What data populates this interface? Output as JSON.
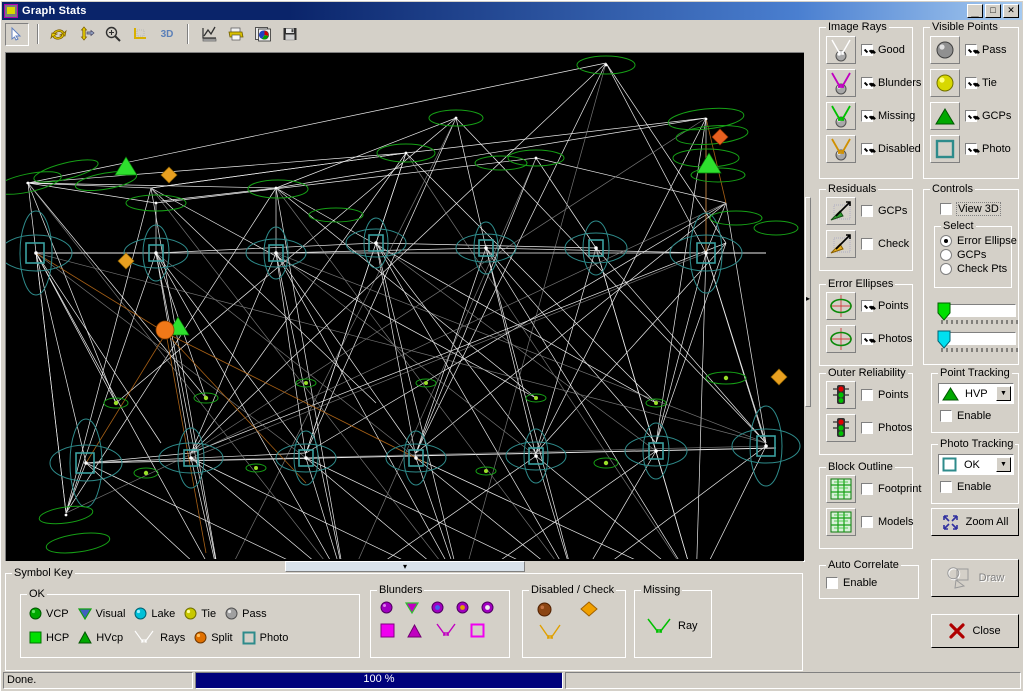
{
  "window": {
    "title": "Graph Stats",
    "icon": "app-icon",
    "buttons": {
      "minimize": "_",
      "maximize": "□",
      "close": "✕"
    }
  },
  "toolbar": {
    "items": [
      {
        "name": "select-arrow",
        "label": "",
        "pressed": true
      },
      {
        "name": "rotate",
        "label": ""
      },
      {
        "name": "pan-move",
        "label": ""
      },
      {
        "name": "zoom",
        "label": ""
      },
      {
        "name": "axes",
        "label": ""
      },
      {
        "name": "view-3d",
        "label": "3D"
      },
      {
        "name": "graph",
        "label": ""
      },
      {
        "name": "print",
        "label": ""
      },
      {
        "name": "palette",
        "label": ""
      },
      {
        "name": "save",
        "label": ""
      }
    ]
  },
  "image_rays": {
    "legend": "Image Rays",
    "items": [
      {
        "label": "Good",
        "checked": true,
        "color": "#ffffff"
      },
      {
        "label": "Blunders",
        "checked": true,
        "color": "#c000c0"
      },
      {
        "label": "Missing",
        "checked": true,
        "color": "#00c000"
      },
      {
        "label": "Disabled",
        "checked": true,
        "color": "#d09000"
      }
    ]
  },
  "residuals": {
    "legend": "Residuals",
    "items": [
      {
        "label": "GCPs",
        "checked": false,
        "color": "#2e9b2e"
      },
      {
        "label": "Check",
        "checked": false,
        "color": "#e8b020"
      }
    ]
  },
  "error_ellipses": {
    "legend": "Error Ellipses",
    "items": [
      {
        "label": "Points",
        "checked": true
      },
      {
        "label": "Photos",
        "checked": true
      }
    ]
  },
  "outer_reliability": {
    "legend": "Outer Reliability",
    "items": [
      {
        "label": "Points",
        "checked": false
      },
      {
        "label": "Photos",
        "checked": false
      }
    ]
  },
  "block_outline": {
    "legend": "Block Outline",
    "items": [
      {
        "label": "Footprint",
        "checked": false
      },
      {
        "label": "Models",
        "checked": false
      }
    ]
  },
  "auto_correlate": {
    "legend": "Auto Correlate",
    "items": [
      {
        "label": "Enable",
        "checked": false
      }
    ]
  },
  "visible_points": {
    "legend": "Visible Points",
    "items": [
      {
        "label": "Pass",
        "checked": true,
        "symbol": "circle",
        "color": "#909090"
      },
      {
        "label": "Tie",
        "checked": true,
        "symbol": "circle",
        "color": "#d8d800"
      },
      {
        "label": "GCPs",
        "checked": true,
        "symbol": "triangle",
        "color": "#00a800"
      },
      {
        "label": "Photo",
        "checked": true,
        "symbol": "square",
        "color": "#2e8b8b"
      }
    ]
  },
  "controls": {
    "legend": "Controls",
    "view_3d": {
      "label": "View 3D",
      "checked": false
    },
    "select": {
      "legend": "Select",
      "options": [
        {
          "label": "Error Ellipse",
          "selected": true
        },
        {
          "label": "GCPs",
          "selected": false
        },
        {
          "label": "Check Pts",
          "selected": false
        }
      ]
    },
    "sliders": [
      {
        "name": "ellipse-scale-slider",
        "color": "#00e000",
        "value": 0
      },
      {
        "name": "ray-scale-slider",
        "color": "#00e0f0",
        "value": 0
      }
    ]
  },
  "point_tracking": {
    "legend": "Point Tracking",
    "value": "HVP",
    "symbol": "triangle",
    "enable": {
      "label": "Enable",
      "checked": false
    }
  },
  "photo_tracking": {
    "legend": "Photo Tracking",
    "value": "OK",
    "symbol": "square",
    "enable": {
      "label": "Enable",
      "checked": false
    }
  },
  "actions": {
    "zoom_all": "Zoom All",
    "draw": "Draw",
    "close": "Close"
  },
  "symbol_key": {
    "legend": "Symbol Key",
    "ok": {
      "legend": "OK",
      "row1": [
        {
          "label": "VCP",
          "symbol": "circle",
          "color": "#00a800"
        },
        {
          "label": "Visual",
          "symbol": "triangle-down",
          "color": "#4060c0"
        },
        {
          "label": "Lake",
          "symbol": "circle",
          "color": "#00c0d8"
        },
        {
          "label": "Tie",
          "symbol": "circle",
          "color": "#c8c800"
        },
        {
          "label": "Pass",
          "symbol": "circle",
          "color": "#a0a0a0"
        }
      ],
      "row2": [
        {
          "label": "HCP",
          "symbol": "square",
          "color": "#00e000"
        },
        {
          "label": "HVcp",
          "symbol": "triangle-up",
          "color": "#00a800"
        },
        {
          "label": "Rays",
          "symbol": "rays",
          "color": "#ffffff"
        },
        {
          "label": "Split",
          "symbol": "circle",
          "color": "#e07000"
        },
        {
          "label": "Photo",
          "symbol": "square-open",
          "color": "#2e8b8b"
        }
      ]
    },
    "blunders": {
      "legend": "Blunders",
      "row1": [
        {
          "symbol": "circle",
          "color": "#a000c0"
        },
        {
          "symbol": "triangle-down",
          "color": "#c000c0"
        },
        {
          "symbol": "circle-dot",
          "color": "#a000c0",
          "dot": "#4060f0"
        },
        {
          "symbol": "circle-dot",
          "color": "#a000c0",
          "dot": "#e0a000"
        },
        {
          "symbol": "circle-dot",
          "color": "#a000c0",
          "dot": "#e0e0e0"
        }
      ],
      "row2": [
        {
          "symbol": "square",
          "color": "#f000f0"
        },
        {
          "symbol": "triangle-up",
          "color": "#c000c0"
        },
        {
          "symbol": "rays",
          "color": "#c000c0"
        },
        {
          "symbol": "square-open",
          "color": "#f000f0"
        }
      ]
    },
    "disabled_check": {
      "legend": "Disabled / Check",
      "row1": [
        {
          "symbol": "circle",
          "color": "#8b4513"
        },
        {
          "symbol": "diamond",
          "color": "#f0a000"
        }
      ],
      "row2": [
        {
          "symbol": "rays",
          "color": "#e0a000"
        }
      ]
    },
    "missing": {
      "legend": "Missing",
      "items": [
        {
          "label": "Ray",
          "symbol": "rays",
          "color": "#00c000"
        }
      ]
    }
  },
  "statusbar": {
    "message": "Done.",
    "progress_text": "100 %",
    "progress_value": 100
  },
  "graph": {
    "background": "#000000",
    "description": "Photogrammetric block adjustment network: camera stations connected by image rays with error ellipses"
  }
}
